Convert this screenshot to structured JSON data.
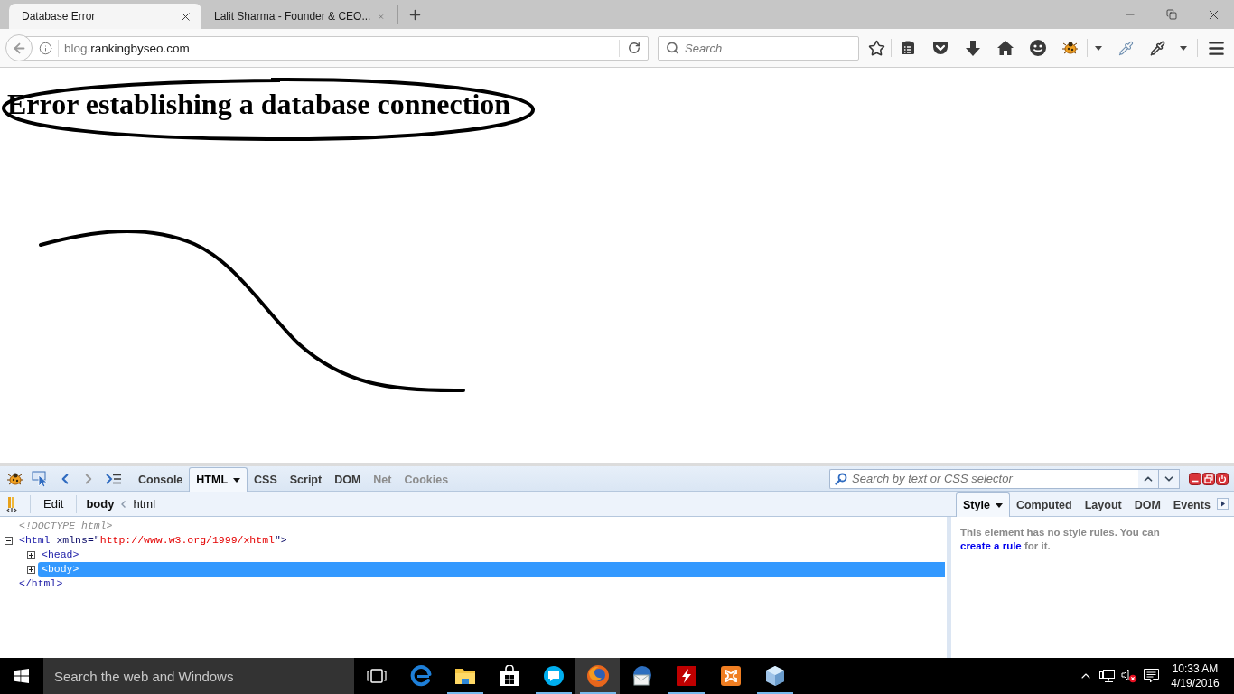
{
  "browser": {
    "tabs": [
      {
        "title": "Database Error",
        "selected": true
      },
      {
        "title": "Lalit Sharma - Founder & CEO...",
        "selected": false
      }
    ],
    "address": {
      "subdomain": "blog.",
      "domain": "rankingbyseo.com"
    },
    "search": {
      "placeholder": "Search"
    }
  },
  "page": {
    "heading": "Error establishing a database connection"
  },
  "devtools": {
    "panel_tabs": [
      {
        "label": "Console",
        "selected": false,
        "disabled": false
      },
      {
        "label": "HTML",
        "selected": true,
        "disabled": false
      },
      {
        "label": "CSS",
        "selected": false,
        "disabled": false
      },
      {
        "label": "Script",
        "selected": false,
        "disabled": false
      },
      {
        "label": "DOM",
        "selected": false,
        "disabled": false
      },
      {
        "label": "Net",
        "selected": false,
        "disabled": true
      },
      {
        "label": "Cookies",
        "selected": false,
        "disabled": true
      }
    ],
    "search": {
      "placeholder": "Search by text or CSS selector"
    },
    "edit_button": "Edit",
    "breadcrumbs": [
      {
        "label": "body",
        "selected": true
      },
      {
        "label": "html",
        "selected": false
      }
    ],
    "side_tabs": [
      {
        "label": "Style",
        "selected": true
      },
      {
        "label": "Computed",
        "selected": false
      },
      {
        "label": "Layout",
        "selected": false
      },
      {
        "label": "DOM",
        "selected": false
      },
      {
        "label": "Events",
        "selected": false
      }
    ],
    "html_tree": [
      {
        "kind": "doctype",
        "text": "<!DOCTYPE html>"
      },
      {
        "kind": "element",
        "expanded": true,
        "selected": false,
        "segments": [
          {
            "kind": "tag",
            "text": "<html"
          },
          {
            "kind": "attribute",
            "text": " xmlns=\""
          },
          {
            "kind": "value",
            "text": "http://www.w3.org/1999/xhtml"
          },
          {
            "kind": "attribute",
            "text": "\">"
          }
        ],
        "children": [
          {
            "kind": "element",
            "expanded": false,
            "selected": false,
            "segments": [
              {
                "kind": "tag",
                "text": "<head>"
              }
            ]
          },
          {
            "kind": "element",
            "expanded": false,
            "selected": true,
            "segments": [
              {
                "kind": "tag",
                "text": "<body>"
              }
            ]
          }
        ],
        "closing_tag": "</html>"
      }
    ],
    "style_panel": {
      "message": "This element has no style rules. You can",
      "link": "create a rule",
      "message_end": "for it."
    }
  },
  "taskbar": {
    "search": {
      "placeholder": "Search the web and Windows"
    },
    "apps": [
      {
        "kind": "task-view",
        "running": false,
        "active": false
      },
      {
        "kind": "edge",
        "running": false,
        "active": false
      },
      {
        "kind": "file-explorer",
        "running": true,
        "active": false
      },
      {
        "kind": "store",
        "running": false,
        "active": false
      },
      {
        "kind": "skype",
        "running": true,
        "active": false
      },
      {
        "kind": "firefox",
        "running": true,
        "active": true
      },
      {
        "kind": "thunderbird",
        "running": false,
        "active": false
      },
      {
        "kind": "filezilla",
        "running": true,
        "active": false
      },
      {
        "kind": "xampp",
        "running": false,
        "active": false
      },
      {
        "kind": "cube",
        "running": true,
        "active": false
      }
    ],
    "clock": {
      "time": "10:33 AM",
      "date": "4/19/2016"
    }
  }
}
